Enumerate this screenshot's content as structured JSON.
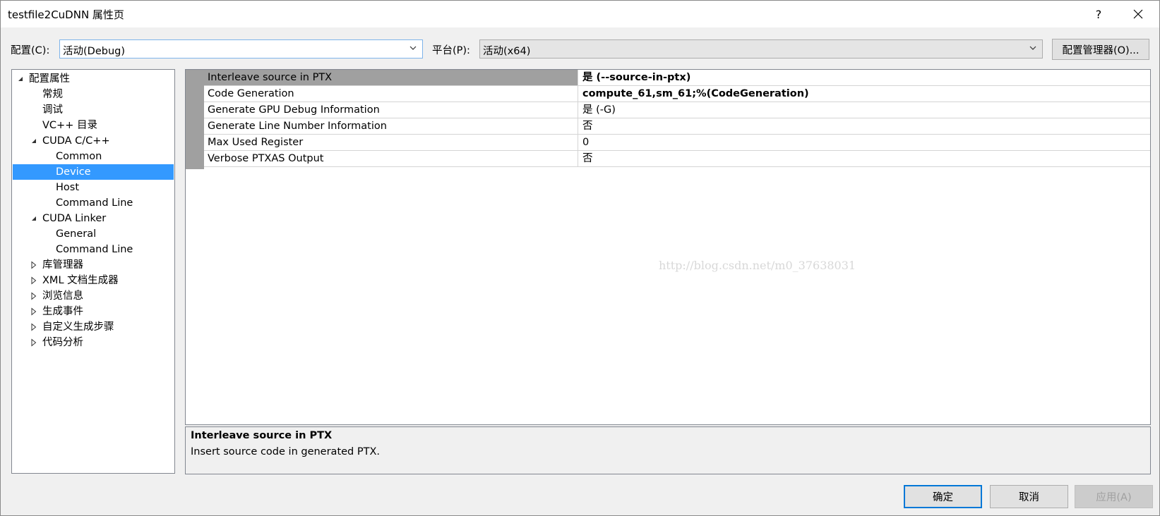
{
  "window": {
    "title": "testfile2CuDNN 属性页",
    "help_label": "?",
    "close_label": "✕"
  },
  "config": {
    "label": "配置(C):",
    "value": "活动(Debug)"
  },
  "platform": {
    "label": "平台(P):",
    "value": "活动(x64)"
  },
  "config_manager_label": "配置管理器(O)...",
  "tree": {
    "items": [
      {
        "label": "配置属性",
        "expander": "expanded"
      },
      {
        "label": "常规"
      },
      {
        "label": "调试"
      },
      {
        "label": "VC++ 目录"
      },
      {
        "label": "CUDA C/C++",
        "expander": "expanded"
      },
      {
        "label": "Common"
      },
      {
        "label": "Device",
        "selected": true
      },
      {
        "label": "Host"
      },
      {
        "label": "Command Line"
      },
      {
        "label": "CUDA Linker",
        "expander": "expanded"
      },
      {
        "label": "General"
      },
      {
        "label": "Command Line"
      },
      {
        "label": "库管理器",
        "expander": "collapsed"
      },
      {
        "label": "XML 文档生成器",
        "expander": "collapsed"
      },
      {
        "label": "浏览信息",
        "expander": "collapsed"
      },
      {
        "label": "生成事件",
        "expander": "collapsed"
      },
      {
        "label": "自定义生成步骤",
        "expander": "collapsed"
      },
      {
        "label": "代码分析",
        "expander": "collapsed"
      }
    ]
  },
  "grid": {
    "rows": [
      {
        "name": "Interleave source in PTX",
        "value": "是 (--source-in-ptx)",
        "bold": true,
        "selected": true
      },
      {
        "name": "Code Generation",
        "value": "compute_61,sm_61;%(CodeGeneration)",
        "bold": true
      },
      {
        "name": "Generate GPU Debug Information",
        "value": "是 (-G)"
      },
      {
        "name": "Generate Line Number Information",
        "value": "否"
      },
      {
        "name": "Max Used Register",
        "value": "0"
      },
      {
        "name": "Verbose PTXAS Output",
        "value": "否"
      }
    ],
    "watermark": "http://blog.csdn.net/m0_37638031"
  },
  "description": {
    "title": "Interleave source in PTX",
    "text": "Insert source code in generated PTX."
  },
  "buttons": {
    "ok": "确定",
    "cancel": "取消",
    "apply": "应用(A)"
  },
  "colors": {
    "selection": "#3399ff",
    "focus_border": "#0078d7",
    "grid_selected": "#a0a0a0"
  }
}
